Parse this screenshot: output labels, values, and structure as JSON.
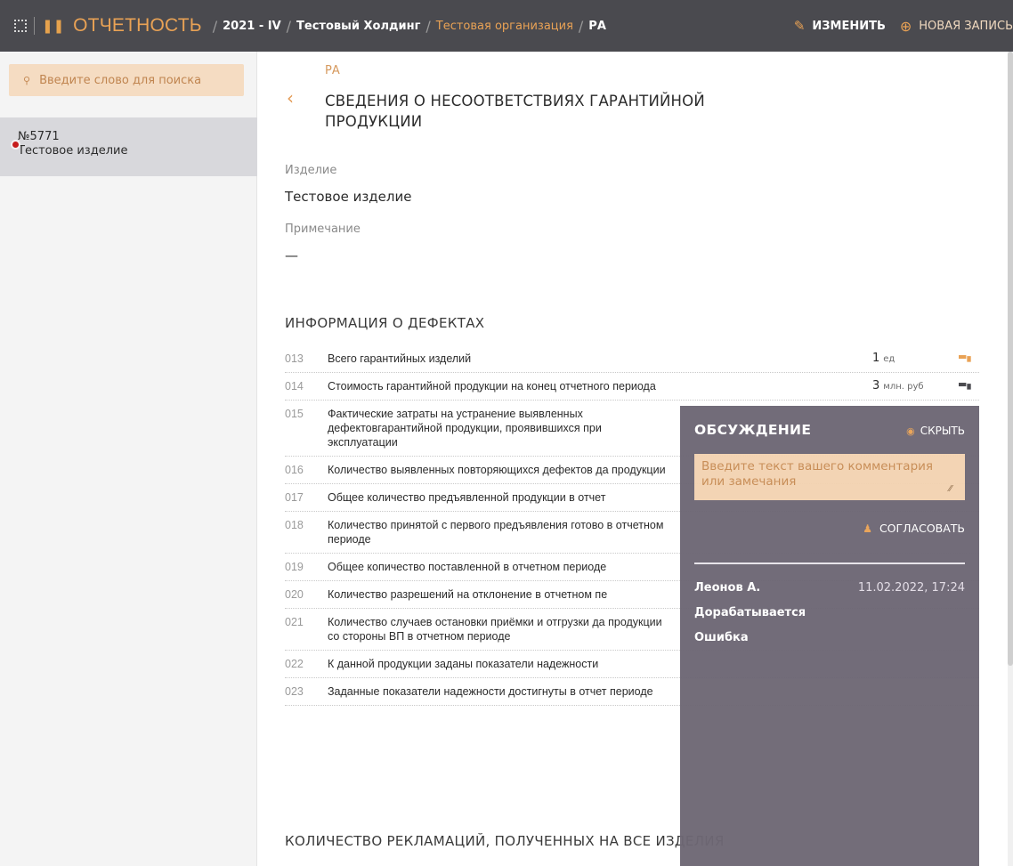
{
  "topbar": {
    "app_title": "ОТЧЕТНОСТЬ",
    "breadcrumbs": [
      "2021 - IV",
      "Тестовый Холдинг",
      "Тестовая организация",
      "РА"
    ],
    "edit_label": "ИЗМЕНИТЬ",
    "new_label": "НОВАЯ ЗАПИСЬ"
  },
  "sidebar": {
    "search_placeholder": "Введите слово для поиска",
    "items": [
      {
        "number": "№5771",
        "name": "Тестовое изделие"
      }
    ]
  },
  "main": {
    "subtitle": "РА",
    "title": "СВЕДЕНИЯ О НЕСООТВЕТСТВИЯХ ГАРАНТИЙНОЙ ПРОДУКЦИИ",
    "fields": [
      {
        "label": "Изделие",
        "value": "Тестовое изделие"
      },
      {
        "label": "Примечание",
        "value": "—"
      }
    ],
    "section1_title": "ИНФОРМАЦИЯ О ДЕФЕКТАХ",
    "rows": [
      {
        "code": "013",
        "text": "Всего гарантийных изделий",
        "value": "1",
        "unit": "ед"
      },
      {
        "code": "014",
        "text": "Стоимость гарантийной продукции на конец отчетного периода",
        "value": "3",
        "unit": "млн. руб"
      },
      {
        "code": "015",
        "text": "Фактические затраты на устранение выявленных дефектовгарантийной продукции, проявившихся при эксплуатации",
        "value": "",
        "unit": ""
      },
      {
        "code": "016",
        "text": "Количество выявленных повторяющихся дефектов да продукции",
        "value": "",
        "unit": ""
      },
      {
        "code": "017",
        "text": "Общее количество предъявленной продукции в отчет",
        "value": "",
        "unit": ""
      },
      {
        "code": "018",
        "text": "Количество принятой с первого предъявления готово в отчетном периоде",
        "value": "",
        "unit": ""
      },
      {
        "code": "019",
        "text": "Общее копичество поставленной в отчетном периоде",
        "value": "",
        "unit": ""
      },
      {
        "code": "020",
        "text": "Количество разрешений на отклонение в отчетном пе",
        "value": "",
        "unit": ""
      },
      {
        "code": "021",
        "text": "Количество случаев остановки приёмки и отгрузки да продукции со стороны ВП в отчетном периоде",
        "value": "",
        "unit": ""
      },
      {
        "code": "022",
        "text": "К данной продукции заданы показатели надежности",
        "value": "",
        "unit": ""
      },
      {
        "code": "023",
        "text": "Заданные показатели надежности достигнуты в отчет периоде",
        "value": "",
        "unit": ""
      }
    ],
    "section2_title": "КОЛИЧЕСТВО РЕКЛАМАЦИЙ, ПОЛУЧЕННЫХ НА ВСЕ ИЗДЕЛИЯ"
  },
  "discussion": {
    "title": "ОБСУЖДЕНИЕ",
    "hide_label": "СКРЫТЬ",
    "comment_placeholder": "Введите текст вашего комментария или замечания",
    "approve_label": "СОГЛАСОВАТЬ",
    "comments": [
      {
        "author": "Леонов А.",
        "date": "11.02.2022, 17:24",
        "status": "Дорабатывается",
        "text": "Ошибка"
      }
    ]
  },
  "colors": {
    "topbar_bg": "#4a4a4f",
    "accent": "#e9a255",
    "panel_bg": "#6d6774",
    "search_bg": "#f5dcc2"
  }
}
